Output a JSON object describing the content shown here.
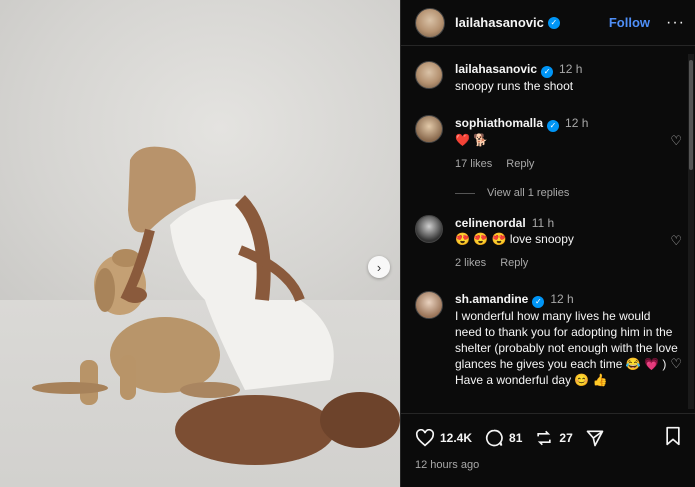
{
  "post": {
    "author": "lailahasanovic",
    "follow_label": "Follow",
    "caption": {
      "user": "lailahasanovic",
      "time": "12 h",
      "text": "snoopy runs the shoot"
    }
  },
  "comments": [
    {
      "user": "sophiathomalla",
      "time": "12 h",
      "text": "❤️ 🐕",
      "likes": "17 likes",
      "reply_label": "Reply",
      "view_replies": "View all 1 replies"
    },
    {
      "user": "celinenordal",
      "time": "11 h",
      "text": "😍 😍 😍 love snoopy",
      "likes": "2 likes",
      "reply_label": "Reply"
    },
    {
      "user": "sh.amandine",
      "time": "12 h",
      "text": "I wonderful how many lives he would need to thank you for adopting him in the shelter (probably not enough with the love glances he gives you each time 😂 💗 ) Have a wonderful day 😊 👍"
    }
  ],
  "actions": {
    "likes": "12.4K",
    "comments": "81",
    "reposts": "27",
    "posted_ago": "12 hours ago"
  },
  "icons": [
    "verified-badge",
    "more-icon",
    "heart-icon",
    "comment-icon",
    "repost-icon",
    "share-icon",
    "bookmark-icon",
    "chevron-right-icon"
  ],
  "colors": {
    "accent": "#4f8ff7",
    "verified": "#0095f6",
    "panel_bg": "#0b0b0b"
  }
}
